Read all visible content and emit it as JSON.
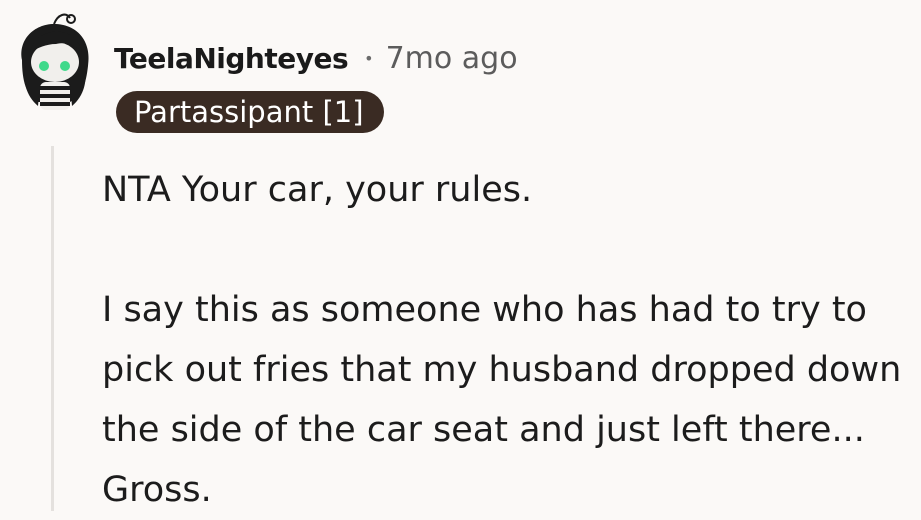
{
  "comment": {
    "username": "TeelaNighteyes",
    "separator": "•",
    "timestamp": "7mo ago",
    "flair": "Partassipant [1]",
    "paragraphs": [
      "NTA Your car, your rules.",
      "I say this as someone who has had to try to pick out fries that my husband dropped down the side of the car seat and just left there... Gross."
    ]
  },
  "avatar": {
    "icon": "snoo-avatar-icon",
    "eye_color": "#3fd98a",
    "hair_color": "#1b1b1b",
    "skin_color": "#f1efec"
  },
  "colors": {
    "background": "#fbf9f7",
    "flair_background": "#3a2b23",
    "flair_text": "#ffffff",
    "thread_line": "#e4e1de"
  }
}
